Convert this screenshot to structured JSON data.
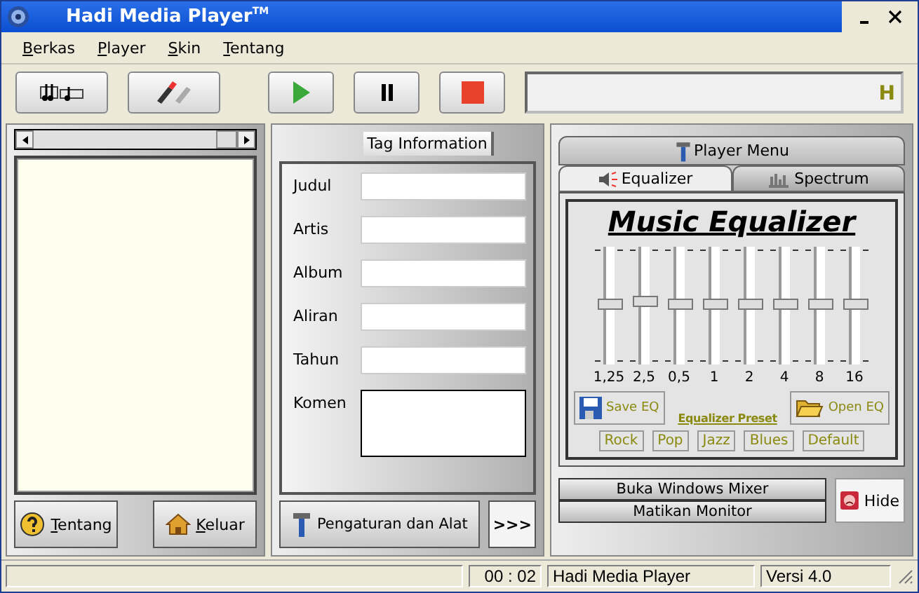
{
  "window": {
    "title": "Hadi Media Player",
    "title_mark": "TM"
  },
  "menu": [
    "Berkas",
    "Player",
    "Skin",
    "Tentang"
  ],
  "toolbar": {
    "display_text": "H"
  },
  "playlist": {
    "buttons": [
      "Tentang",
      "Keluar"
    ]
  },
  "tag_info": {
    "tab": "Tag Information",
    "fields": [
      {
        "label": "Judul",
        "kind": "line"
      },
      {
        "label": "Artis",
        "kind": "line"
      },
      {
        "label": "Album",
        "kind": "line"
      },
      {
        "label": "Aliran",
        "kind": "line"
      },
      {
        "label": "Tahun",
        "kind": "line"
      },
      {
        "label": "Komen",
        "kind": "area"
      }
    ],
    "buttons": [
      "Pengaturan dan Alat",
      ">>>"
    ]
  },
  "player_menu": {
    "title": "Player Menu",
    "tabs": [
      {
        "label": "Equalizer",
        "selected": true
      },
      {
        "label": "Spectrum",
        "selected": false
      }
    ],
    "equalizer": {
      "title": "Music Equalizer",
      "bands": [
        {
          "label": "1,25",
          "level": 0.5
        },
        {
          "label": "2,5",
          "level": 0.52
        },
        {
          "label": "0,5",
          "level": 0.5
        },
        {
          "label": "1",
          "level": 0.5
        },
        {
          "label": "2",
          "level": 0.5
        },
        {
          "label": "4",
          "level": 0.5
        },
        {
          "label": "8",
          "level": 0.5
        },
        {
          "label": "16",
          "level": 0.5
        }
      ],
      "save": "Save EQ",
      "preset_label": "Equalizer Preset",
      "open": "Open EQ",
      "presets": [
        "Rock",
        "Pop",
        "Jazz",
        "Blues",
        "Default"
      ]
    },
    "buttons": [
      "Buka Windows Mixer",
      "Matikan Monitor"
    ],
    "hide": "Hide"
  },
  "status_bar": {
    "time": "00 : 02",
    "name": "Hadi Media Player",
    "version": "Versi 4.0"
  }
}
